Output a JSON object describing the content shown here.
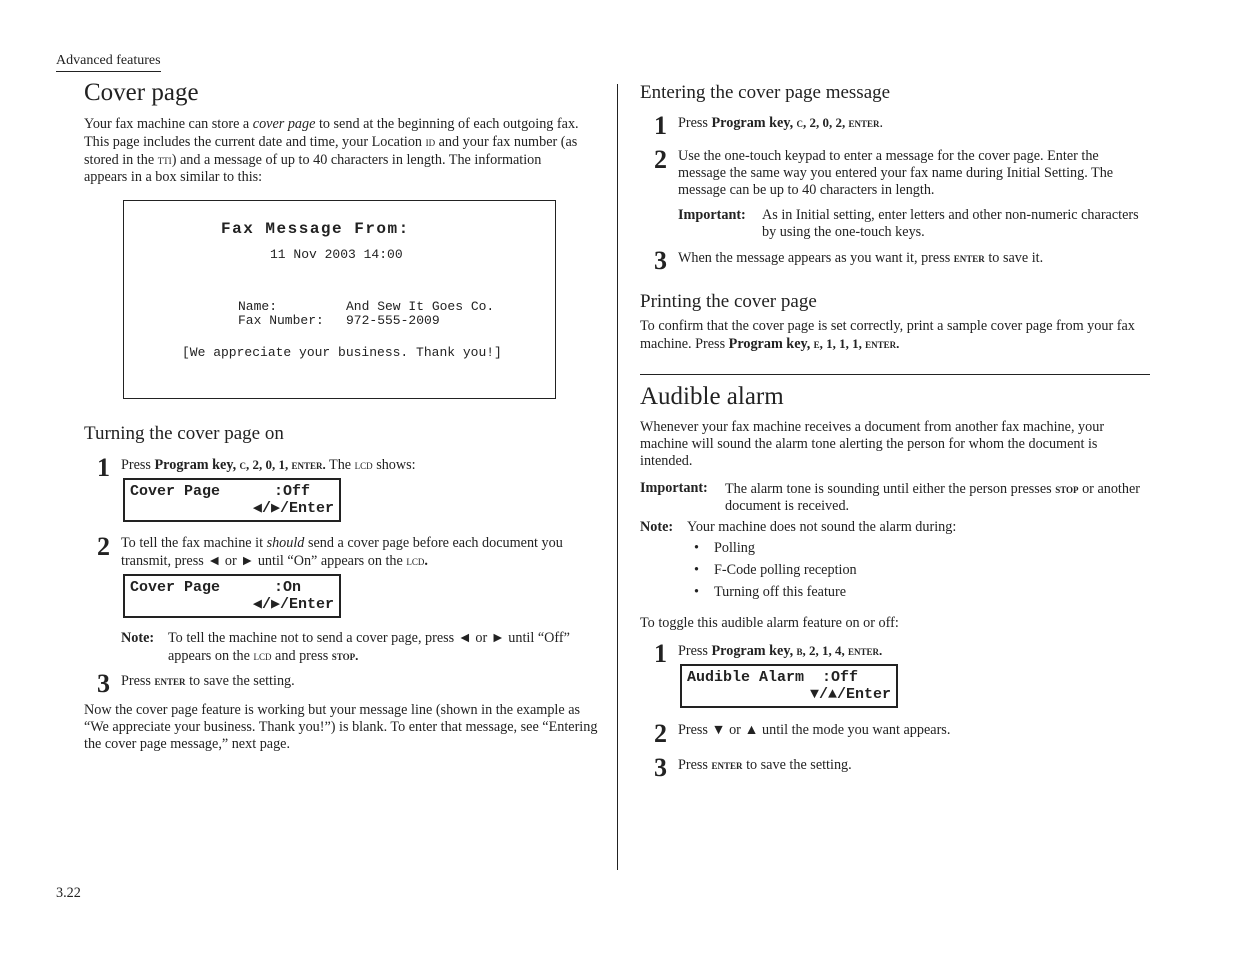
{
  "running_head": "Advanced features",
  "page_number": "3.22",
  "cover_page": {
    "title": "Cover page",
    "intro": {
      "p1": "Your fax machine can store a ",
      "em": "cover page",
      "p2": " to send at the beginning of each outgoing fax. This page includes the current date and time, your Location ",
      "id": "ID",
      "p3": " and your fax number (as stored in the ",
      "tti": "TTI",
      "p4": ") and a message of up to 40 characters in length. The information appears in a box similar to this:"
    },
    "fax_sample": {
      "heading": "Fax Message From:",
      "datetime": "11 Nov 2003  14:00",
      "name_label": "Name:",
      "name_value": "And Sew It Goes Co.",
      "fax_label": "Fax Number:",
      "fax_value": "972-555-2009",
      "message": "[We appreciate your business. Thank you!]"
    },
    "turning_on": {
      "title": "Turning the cover page on",
      "steps": [
        {
          "num": "1",
          "pre": "Press ",
          "bold": "Program key,",
          "keys": " C, 2, 0, 1, ",
          "enter": "ENTER.",
          "post": " The ",
          "lcd": "LCD",
          "post2": " shows:"
        },
        {
          "num": "2",
          "pre": "To tell the fax machine it ",
          "em": "should",
          "mid": " send a cover page before each document you transmit, press ◄ or ► until “On” appears on the ",
          "lcd": "LCD",
          "end": "."
        },
        {
          "num": "3",
          "pre": "Press ",
          "enter": "ENTER",
          "post": " to save the setting."
        }
      ],
      "lcd_off": {
        "line1": "Cover Page      :Off",
        "line2": "◀/▶/Enter"
      },
      "lcd_on": {
        "line1": "Cover Page      :On",
        "line2": "◀/▶/Enter"
      },
      "note": {
        "label": "Note:",
        "pre": "To tell the machine not to send a cover page, press ◄ or ► until “Off” appears on the ",
        "lcd": "LCD",
        "mid": " and press ",
        "stop": "STOP."
      }
    },
    "closing": "Now the cover page feature is working but your message line (shown in the example as “We appreciate your business. Thank you!”) is blank. To enter that message, see “Entering the cover page message,” next page."
  },
  "entering_message": {
    "title": "Entering the cover page message",
    "steps": [
      {
        "num": "1",
        "pre": "Press ",
        "bold": "Program key,",
        "keys": " C, 2, 0, 2, ",
        "enter": "ENTER",
        "post": "."
      },
      {
        "num": "2",
        "text": "Use the one-touch keypad to enter a message for the cover page. Enter the message the same way you entered your fax name during Initial Setting. The message can be up to 40 characters in length."
      },
      {
        "num": "3",
        "pre": "When the message appears as you want it, press ",
        "enter": "ENTER",
        "post": " to save it."
      }
    ],
    "important": {
      "label": "Important:",
      "text": "As in Initial setting, enter letters and other non-numeric characters by using the one-touch keys."
    }
  },
  "printing": {
    "title": "Printing the cover page",
    "pre": "To confirm that the cover page is set correctly, print a sample cover page from your fax machine. Press ",
    "bold": "Program key,",
    "keys": " E, 1, 1, 1, ",
    "enter": "ENTER."
  },
  "audible_alarm": {
    "title": "Audible alarm",
    "intro": "Whenever your fax machine receives a document from another fax machine, your machine will sound the alarm tone alerting the person for whom the document is intended.",
    "important": {
      "label": "Important:",
      "pre": "The alarm tone is sounding until either the person presses ",
      "stop": "STOP",
      "post": " or another document is received."
    },
    "note": {
      "label": "Note:",
      "text": "Your machine does not sound the alarm during:",
      "bullets": [
        "Polling",
        "F-Code polling reception",
        "Turning off this feature"
      ]
    },
    "toggle_text": "To toggle this audible alarm feature on or off:",
    "steps": [
      {
        "num": "1",
        "pre": "Press ",
        "bold": "Program key,",
        "keys": " B, 2, 1, 4, ",
        "enter": "ENTER."
      },
      {
        "num": "2",
        "text": "Press ▼ or ▲ until the mode you want appears."
      },
      {
        "num": "3",
        "pre": "Press ",
        "enter": "ENTER",
        "post": " to save the setting."
      }
    ],
    "lcd": {
      "line1": "Audible Alarm  :Off",
      "line2": "▼/▲/Enter"
    }
  }
}
